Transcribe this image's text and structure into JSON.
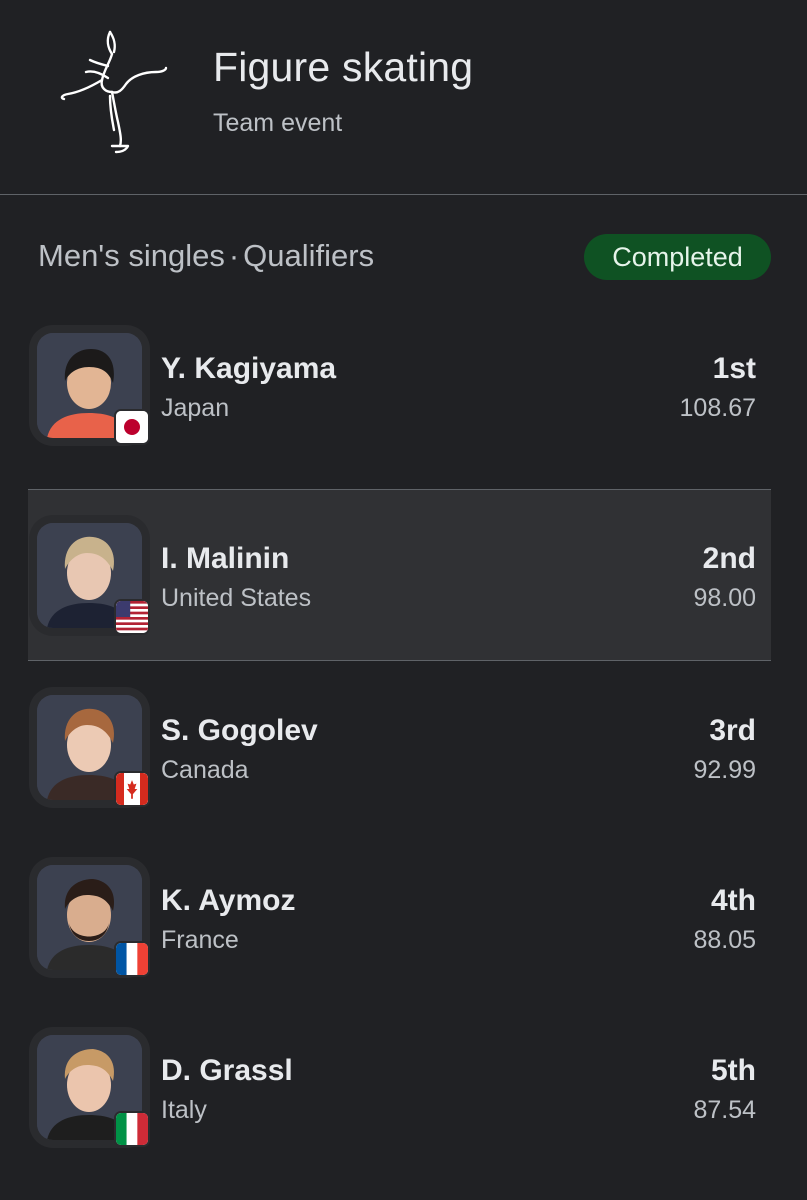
{
  "header": {
    "title": "Figure skating",
    "subtitle": "Team event",
    "logo_icon": "figure-skater-icon"
  },
  "section": {
    "label_left": "Men's singles",
    "separator": "·",
    "label_right": "Qualifiers",
    "status": "Completed",
    "status_color": "#0f5223"
  },
  "athletes": [
    {
      "name": "Y. Kagiyama",
      "country": "Japan",
      "rank": "1st",
      "score": "108.67",
      "flag_icon": "japan-flag-icon",
      "highlighted": false
    },
    {
      "name": "I. Malinin",
      "country": "United States",
      "rank": "2nd",
      "score": "98.00",
      "flag_icon": "usa-flag-icon",
      "highlighted": true
    },
    {
      "name": "S. Gogolev",
      "country": "Canada",
      "rank": "3rd",
      "score": "92.99",
      "flag_icon": "canada-flag-icon",
      "highlighted": false
    },
    {
      "name": "K. Aymoz",
      "country": "France",
      "rank": "4th",
      "score": "88.05",
      "flag_icon": "france-flag-icon",
      "highlighted": false
    },
    {
      "name": "D. Grassl",
      "country": "Italy",
      "rank": "5th",
      "score": "87.54",
      "flag_icon": "italy-flag-icon",
      "highlighted": false
    }
  ],
  "colors": {
    "background": "#202124",
    "highlight_row": "#303134",
    "divider": "#5f6368"
  }
}
